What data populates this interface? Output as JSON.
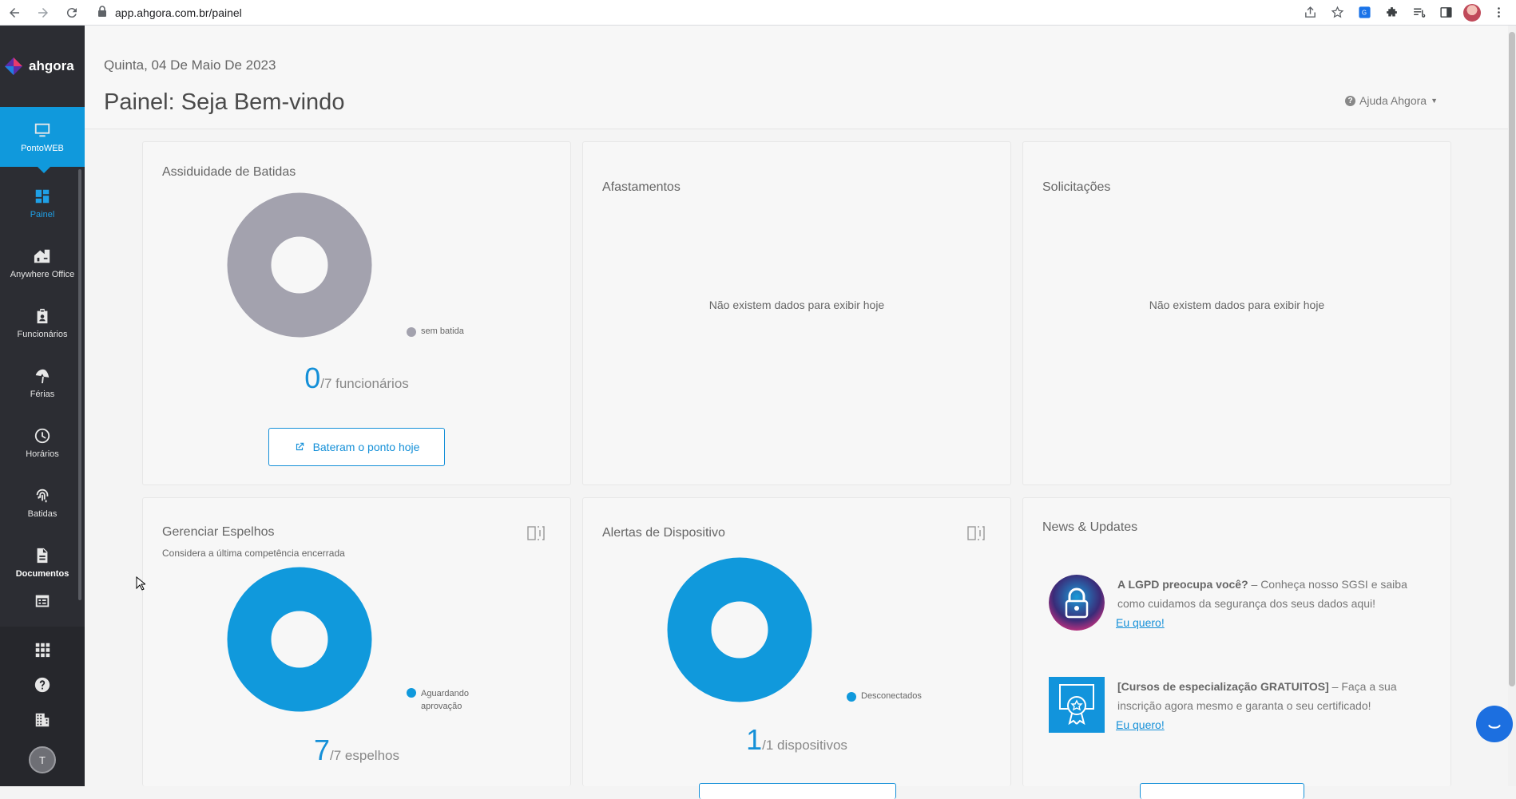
{
  "browser": {
    "url": "app.ahgora.com.br/painel"
  },
  "sidebar": {
    "logo_text": "ahgora",
    "product": {
      "label": "PontoWEB",
      "icon": "monitor-icon"
    },
    "items": [
      {
        "label": "Painel",
        "icon": "dashboard-icon"
      },
      {
        "label": "Anywhere Office",
        "icon": "home-office-icon"
      },
      {
        "label": "Funcionários",
        "icon": "badge-icon"
      },
      {
        "label": "Férias",
        "icon": "beach-umbrella-icon"
      },
      {
        "label": "Horários",
        "icon": "clock-icon"
      },
      {
        "label": "Batidas",
        "icon": "fingerprint-icon"
      },
      {
        "label": "Documentos",
        "icon": "document-icon"
      }
    ],
    "user_initial": "T"
  },
  "header": {
    "date": "Quinta, 04 De Maio De 2023",
    "title": "Painel: Seja Bem-vindo",
    "help_label": "Ajuda Ahgora"
  },
  "cards": {
    "assiduidade": {
      "title": "Assiduidade de Batidas",
      "legend": "sem batida",
      "legend_color": "#a3a2ae",
      "count": "0",
      "count_suffix": "/7 funcionários",
      "button": "Bateram o ponto hoje"
    },
    "afastamentos": {
      "title": "Afastamentos",
      "empty": "Não existem dados para exibir hoje"
    },
    "solicitacoes": {
      "title": "Solicitações",
      "empty": "Não existem dados para exibir hoje"
    },
    "espelhos": {
      "title": "Gerenciar Espelhos",
      "subtitle": "Considera a última competência encerrada",
      "legend": "Aguardando aprovação",
      "legend_color": "#1099dc",
      "count": "7",
      "count_suffix": "/7 espelhos"
    },
    "alertas": {
      "title": "Alertas de Dispositivo",
      "legend": "Desconectados",
      "legend_color": "#1099dc",
      "count": "1",
      "count_suffix": "/1 dispositivos"
    },
    "news": {
      "title": "News & Updates",
      "items": [
        {
          "headline": "A LGPD preocupa você?",
          "body": " – Conheça nosso SGSI e saiba como cuidamos da segurança dos seus dados aqui!",
          "link": "Eu quero!"
        },
        {
          "headline": "[Cursos de especialização GRATUITOS]",
          "body": " – Faça a sua inscrição agora mesmo e garanta o seu certificado!",
          "link": "Eu quero!"
        }
      ]
    }
  },
  "colors": {
    "accent": "#1099dc",
    "sidebar": "#2c2d33",
    "donut_gray": "#a3a2ae"
  }
}
